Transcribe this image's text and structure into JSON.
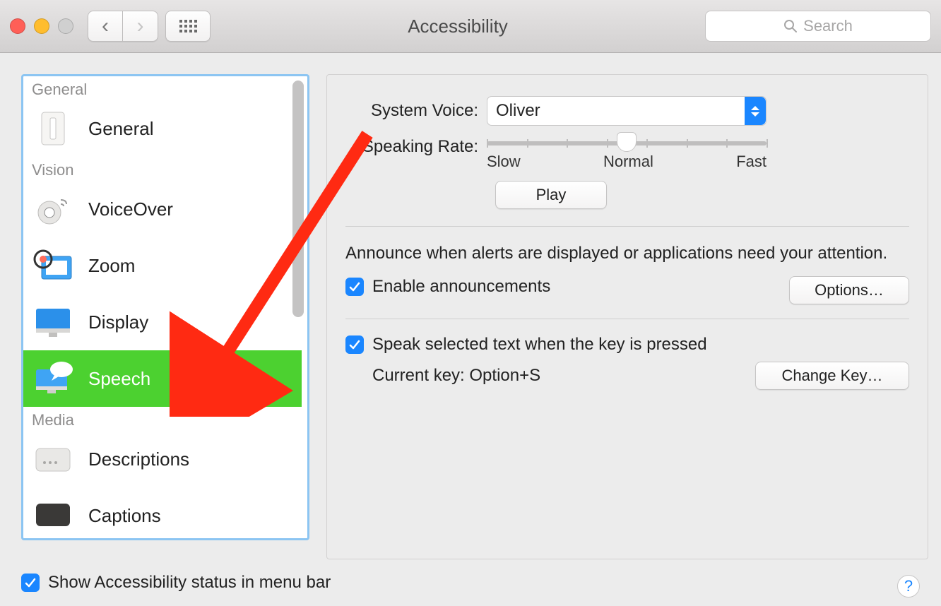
{
  "window": {
    "title": "Accessibility"
  },
  "search": {
    "placeholder": "Search"
  },
  "sidebar": {
    "groups": [
      {
        "label": "General",
        "items": [
          {
            "label": "General"
          }
        ]
      },
      {
        "label": "Vision",
        "items": [
          {
            "label": "VoiceOver"
          },
          {
            "label": "Zoom"
          },
          {
            "label": "Display"
          },
          {
            "label": "Speech",
            "selected": true
          }
        ]
      },
      {
        "label": "Media",
        "items": [
          {
            "label": "Descriptions"
          },
          {
            "label": "Captions"
          }
        ]
      }
    ]
  },
  "panel": {
    "system_voice_label": "System Voice:",
    "system_voice_value": "Oliver",
    "speaking_rate_label": "Speaking Rate:",
    "slider": {
      "min_label": "Slow",
      "mid_label": "Normal",
      "max_label": "Fast"
    },
    "play_button": "Play",
    "announce_text": "Announce when alerts are displayed or applications need your attention.",
    "enable_announcements_label": "Enable announcements",
    "options_button": "Options…",
    "speak_selected_label": "Speak selected text when the key is pressed",
    "current_key_label": "Current key: Option+S",
    "change_key_button": "Change Key…"
  },
  "footer": {
    "show_status_label": "Show Accessibility status in menu bar"
  }
}
